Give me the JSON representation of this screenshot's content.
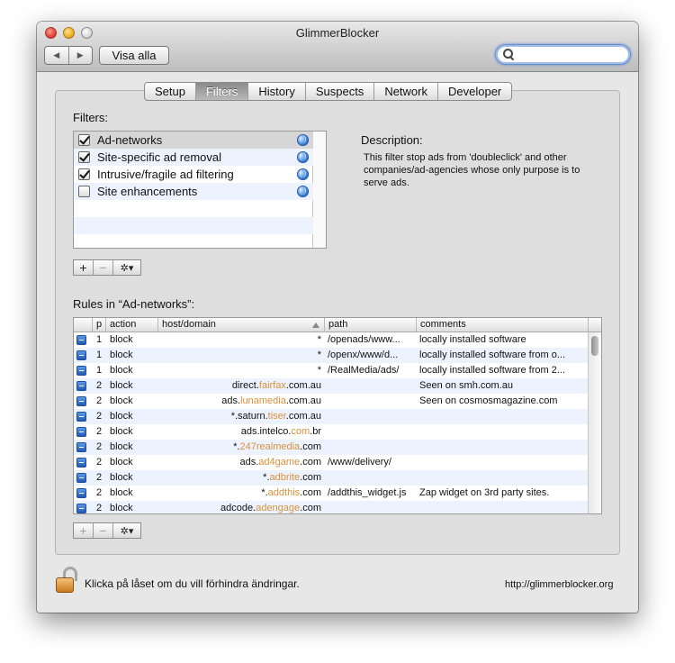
{
  "window": {
    "title": "GlimmerBlocker"
  },
  "toolbar": {
    "show_all_label": "Visa alla",
    "back_glyph": "◀",
    "forward_glyph": "▶",
    "search_placeholder": ""
  },
  "tabs": [
    {
      "label": "Setup",
      "active": false
    },
    {
      "label": "Filters",
      "active": true
    },
    {
      "label": "History",
      "active": false
    },
    {
      "label": "Suspects",
      "active": false
    },
    {
      "label": "Network",
      "active": false
    },
    {
      "label": "Developer",
      "active": false
    }
  ],
  "filters": {
    "heading": "Filters:",
    "items": [
      {
        "label": "Ad-networks",
        "checked": true
      },
      {
        "label": "Site-specific ad removal",
        "checked": true
      },
      {
        "label": "Intrusive/fragile ad filtering",
        "checked": true
      },
      {
        "label": "Site enhancements",
        "checked": false
      }
    ],
    "add_label": "+",
    "remove_label": "−",
    "gear_label": "✲▾"
  },
  "description": {
    "heading": "Description:",
    "text": "This filter stop ads from 'doubleclick' and other companies/ad-agencies whose only purpose is to serve ads."
  },
  "rules": {
    "heading": "Rules in “Ad-networks”:",
    "columns": {
      "p": "p",
      "action": "action",
      "host": "host/domain",
      "path": "path",
      "comments": "comments"
    },
    "rows": [
      {
        "p": "1",
        "action": "block",
        "host_pre": "",
        "host_hl": "",
        "host_post": "*",
        "path": "/openads/www...",
        "comment": "locally installed software"
      },
      {
        "p": "1",
        "action": "block",
        "host_pre": "",
        "host_hl": "",
        "host_post": "*",
        "path": "/openx/www/d...",
        "comment": "locally installed software from o..."
      },
      {
        "p": "1",
        "action": "block",
        "host_pre": "",
        "host_hl": "",
        "host_post": "*",
        "path": "/RealMedia/ads/",
        "comment": "locally installed software from 2..."
      },
      {
        "p": "2",
        "action": "block",
        "host_pre": "direct.",
        "host_hl": "fairfax",
        "host_post": ".com.au",
        "path": "",
        "comment": "Seen on smh.com.au"
      },
      {
        "p": "2",
        "action": "block",
        "host_pre": "ads.",
        "host_hl": "lunamedia",
        "host_post": ".com.au",
        "path": "",
        "comment": "Seen on cosmosmagazine.com"
      },
      {
        "p": "2",
        "action": "block",
        "host_pre": "*.saturn.",
        "host_hl": "tiser",
        "host_post": ".com.au",
        "path": "",
        "comment": ""
      },
      {
        "p": "2",
        "action": "block",
        "host_pre": "ads.intelco.",
        "host_hl": "com",
        "host_post": ".br",
        "path": "",
        "comment": ""
      },
      {
        "p": "2",
        "action": "block",
        "host_pre": "*.",
        "host_hl": "247realmedia",
        "host_post": ".com",
        "path": "",
        "comment": ""
      },
      {
        "p": "2",
        "action": "block",
        "host_pre": "ads.",
        "host_hl": "ad4game",
        "host_post": ".com",
        "path": "/www/delivery/",
        "comment": ""
      },
      {
        "p": "2",
        "action": "block",
        "host_pre": "*.",
        "host_hl": "adbrite",
        "host_post": ".com",
        "path": "",
        "comment": ""
      },
      {
        "p": "2",
        "action": "block",
        "host_pre": "*.",
        "host_hl": "addthis",
        "host_post": ".com",
        "path": "/addthis_widget.js",
        "comment": "Zap widget on 3rd party sites."
      },
      {
        "p": "2",
        "action": "block",
        "host_pre": "adcode.",
        "host_hl": "adengage",
        "host_post": ".com",
        "path": "",
        "comment": ""
      }
    ],
    "add_label": "+",
    "remove_label": "−",
    "gear_label": "✲▾"
  },
  "footer": {
    "lock_text": "Klicka på låset om du vill förhindra ändringar.",
    "url": "http://glimmerblocker.org"
  }
}
